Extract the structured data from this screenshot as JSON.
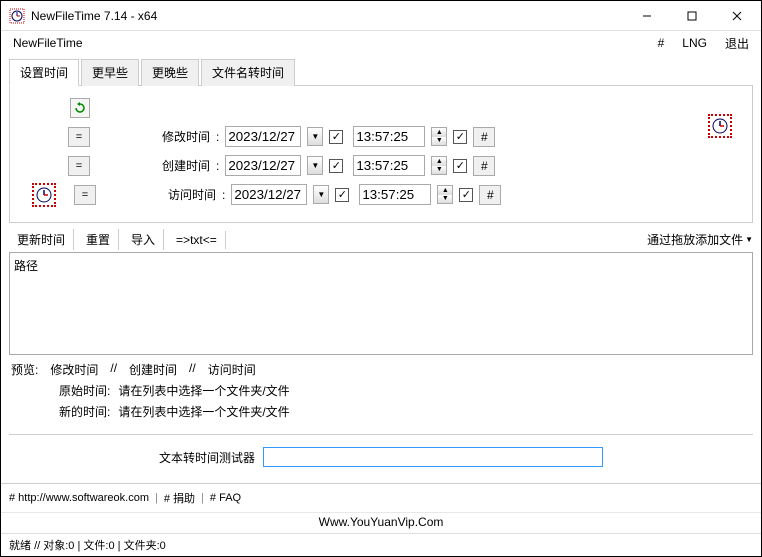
{
  "titlebar": {
    "title": "NewFileTime 7.14 - x64"
  },
  "menubar": {
    "left": "NewFileTime",
    "hash": "#",
    "lng": "LNG",
    "exit": "退出"
  },
  "tabs": {
    "t0": "设置时间",
    "t1": "更早些",
    "t2": "更晚些",
    "t3": "文件名转时间"
  },
  "rows": {
    "eq": "=",
    "modify": "修改时间",
    "create": "创建时间",
    "access": "访问时间",
    "colon": ":",
    "date": "2023/12/27",
    "time": "13:57:25",
    "hash": "#"
  },
  "actions": {
    "update": "更新时间",
    "reset": "重置",
    "import": "导入",
    "txt": "=>txt<=",
    "dragadd": "通过拖放添加文件"
  },
  "list": {
    "header": "路径"
  },
  "preview": {
    "label": "预览:",
    "modify": "修改时间",
    "create": "创建时间",
    "access": "访问时间",
    "sep": "//",
    "orig_label": "原始时间:",
    "new_label": "新的时间:",
    "msg": "请在列表中选择一个文件夹/文件"
  },
  "tester": {
    "label": "文本转时间测试器"
  },
  "footer": {
    "url": "# http://www.softwareok.com",
    "donate": "# 捐助",
    "faq": "# FAQ"
  },
  "branding": "Www.YouYuanVip.Com",
  "status": {
    "ready": "就绪",
    "sep": "//",
    "objects": "对象:0",
    "files": "文件:0",
    "folders": "文件夹:0"
  }
}
